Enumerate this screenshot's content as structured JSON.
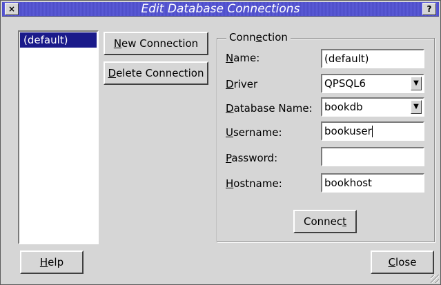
{
  "window": {
    "title": "Edit Database Connections",
    "close_glyph": "×",
    "help_glyph": "?"
  },
  "list": {
    "items": [
      "(default)"
    ]
  },
  "buttons": {
    "new_connection": {
      "pre": "",
      "key": "N",
      "post": "ew Connection"
    },
    "delete_connection": {
      "pre": "",
      "key": "D",
      "post": "elete Connection"
    },
    "connect": {
      "pre": "Connec",
      "key": "t",
      "post": ""
    },
    "help": {
      "pre": "",
      "key": "H",
      "post": "elp"
    },
    "close": {
      "pre": "",
      "key": "C",
      "post": "lose"
    }
  },
  "group": {
    "legend": {
      "pre": "Conn",
      "key": "e",
      "post": "ction"
    },
    "fields": {
      "name": {
        "label_key": "N",
        "label_post": "ame:",
        "value": "(default)"
      },
      "driver": {
        "label_key": "D",
        "label_post": "river",
        "value": "QPSQL6"
      },
      "database_name": {
        "label_key": "D",
        "label_post": "atabase Name:",
        "value": "bookdb"
      },
      "username": {
        "label_key": "U",
        "label_post": "sername:",
        "value": "bookuser"
      },
      "password": {
        "label_key": "P",
        "label_post": "assword:",
        "value": ""
      },
      "hostname": {
        "label_key": "H",
        "label_post": "ostname:",
        "value": "bookhost"
      }
    }
  },
  "icons": {
    "combo_arrow": "chevron-down-icon"
  },
  "colors": {
    "titlebar": "#5050cc",
    "selection": "#1a1a8a",
    "face": "#d6d6d6"
  }
}
